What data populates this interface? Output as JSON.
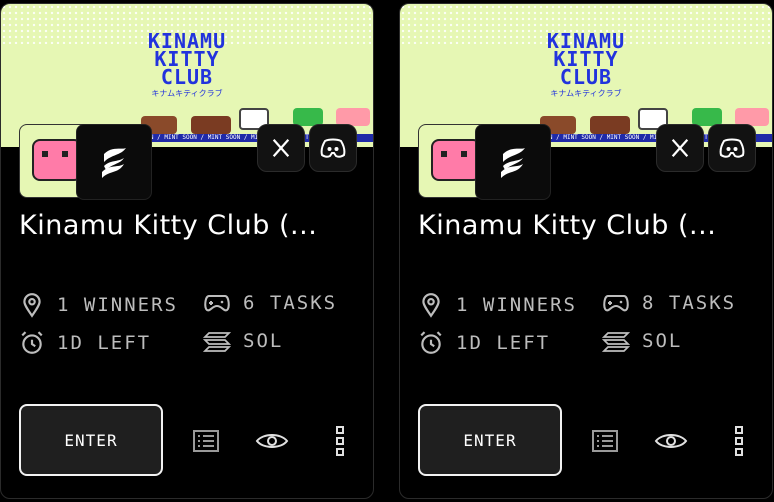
{
  "cards": [
    {
      "banner": {
        "title_line1": "KINAMU",
        "title_line2": "KITTY",
        "title_line3": "CLUB",
        "subtitle_jp": "キナムキティクラブ",
        "ticker": "MINT SOON / MINT SOON / MINT SOON / MINT SOON / MINT"
      },
      "name": "Kinamu Kitty Club (...",
      "winners": "1 WINNERS",
      "tasks": "6 TASKS",
      "time_left": "1D LEFT",
      "chain": "SOL",
      "enter_label": "ENTER"
    },
    {
      "banner": {
        "title_line1": "KINAMU",
        "title_line2": "KITTY",
        "title_line3": "CLUB",
        "subtitle_jp": "キナムキティクラブ",
        "ticker": "MINT SOON / MINT SOON / MINT SOON / MINT SOON / MINT"
      },
      "name": "Kinamu Kitty Club (...",
      "winners": "1 WINNERS",
      "tasks": "8 TASKS",
      "time_left": "1D LEFT",
      "chain": "SOL",
      "enter_label": "ENTER"
    }
  ],
  "colors": {
    "banner_bg": "#e6f7b4",
    "banner_text": "#2233dd",
    "pig": "#ff7ba8",
    "card_bg": "#000000",
    "muted_text": "#bdbdbd"
  },
  "icons": [
    "x-logo-icon",
    "discord-icon",
    "location-pin-icon",
    "gamepad-icon",
    "alarm-clock-icon",
    "solana-icon",
    "list-icon",
    "eye-icon",
    "more-vertical-icon"
  ]
}
